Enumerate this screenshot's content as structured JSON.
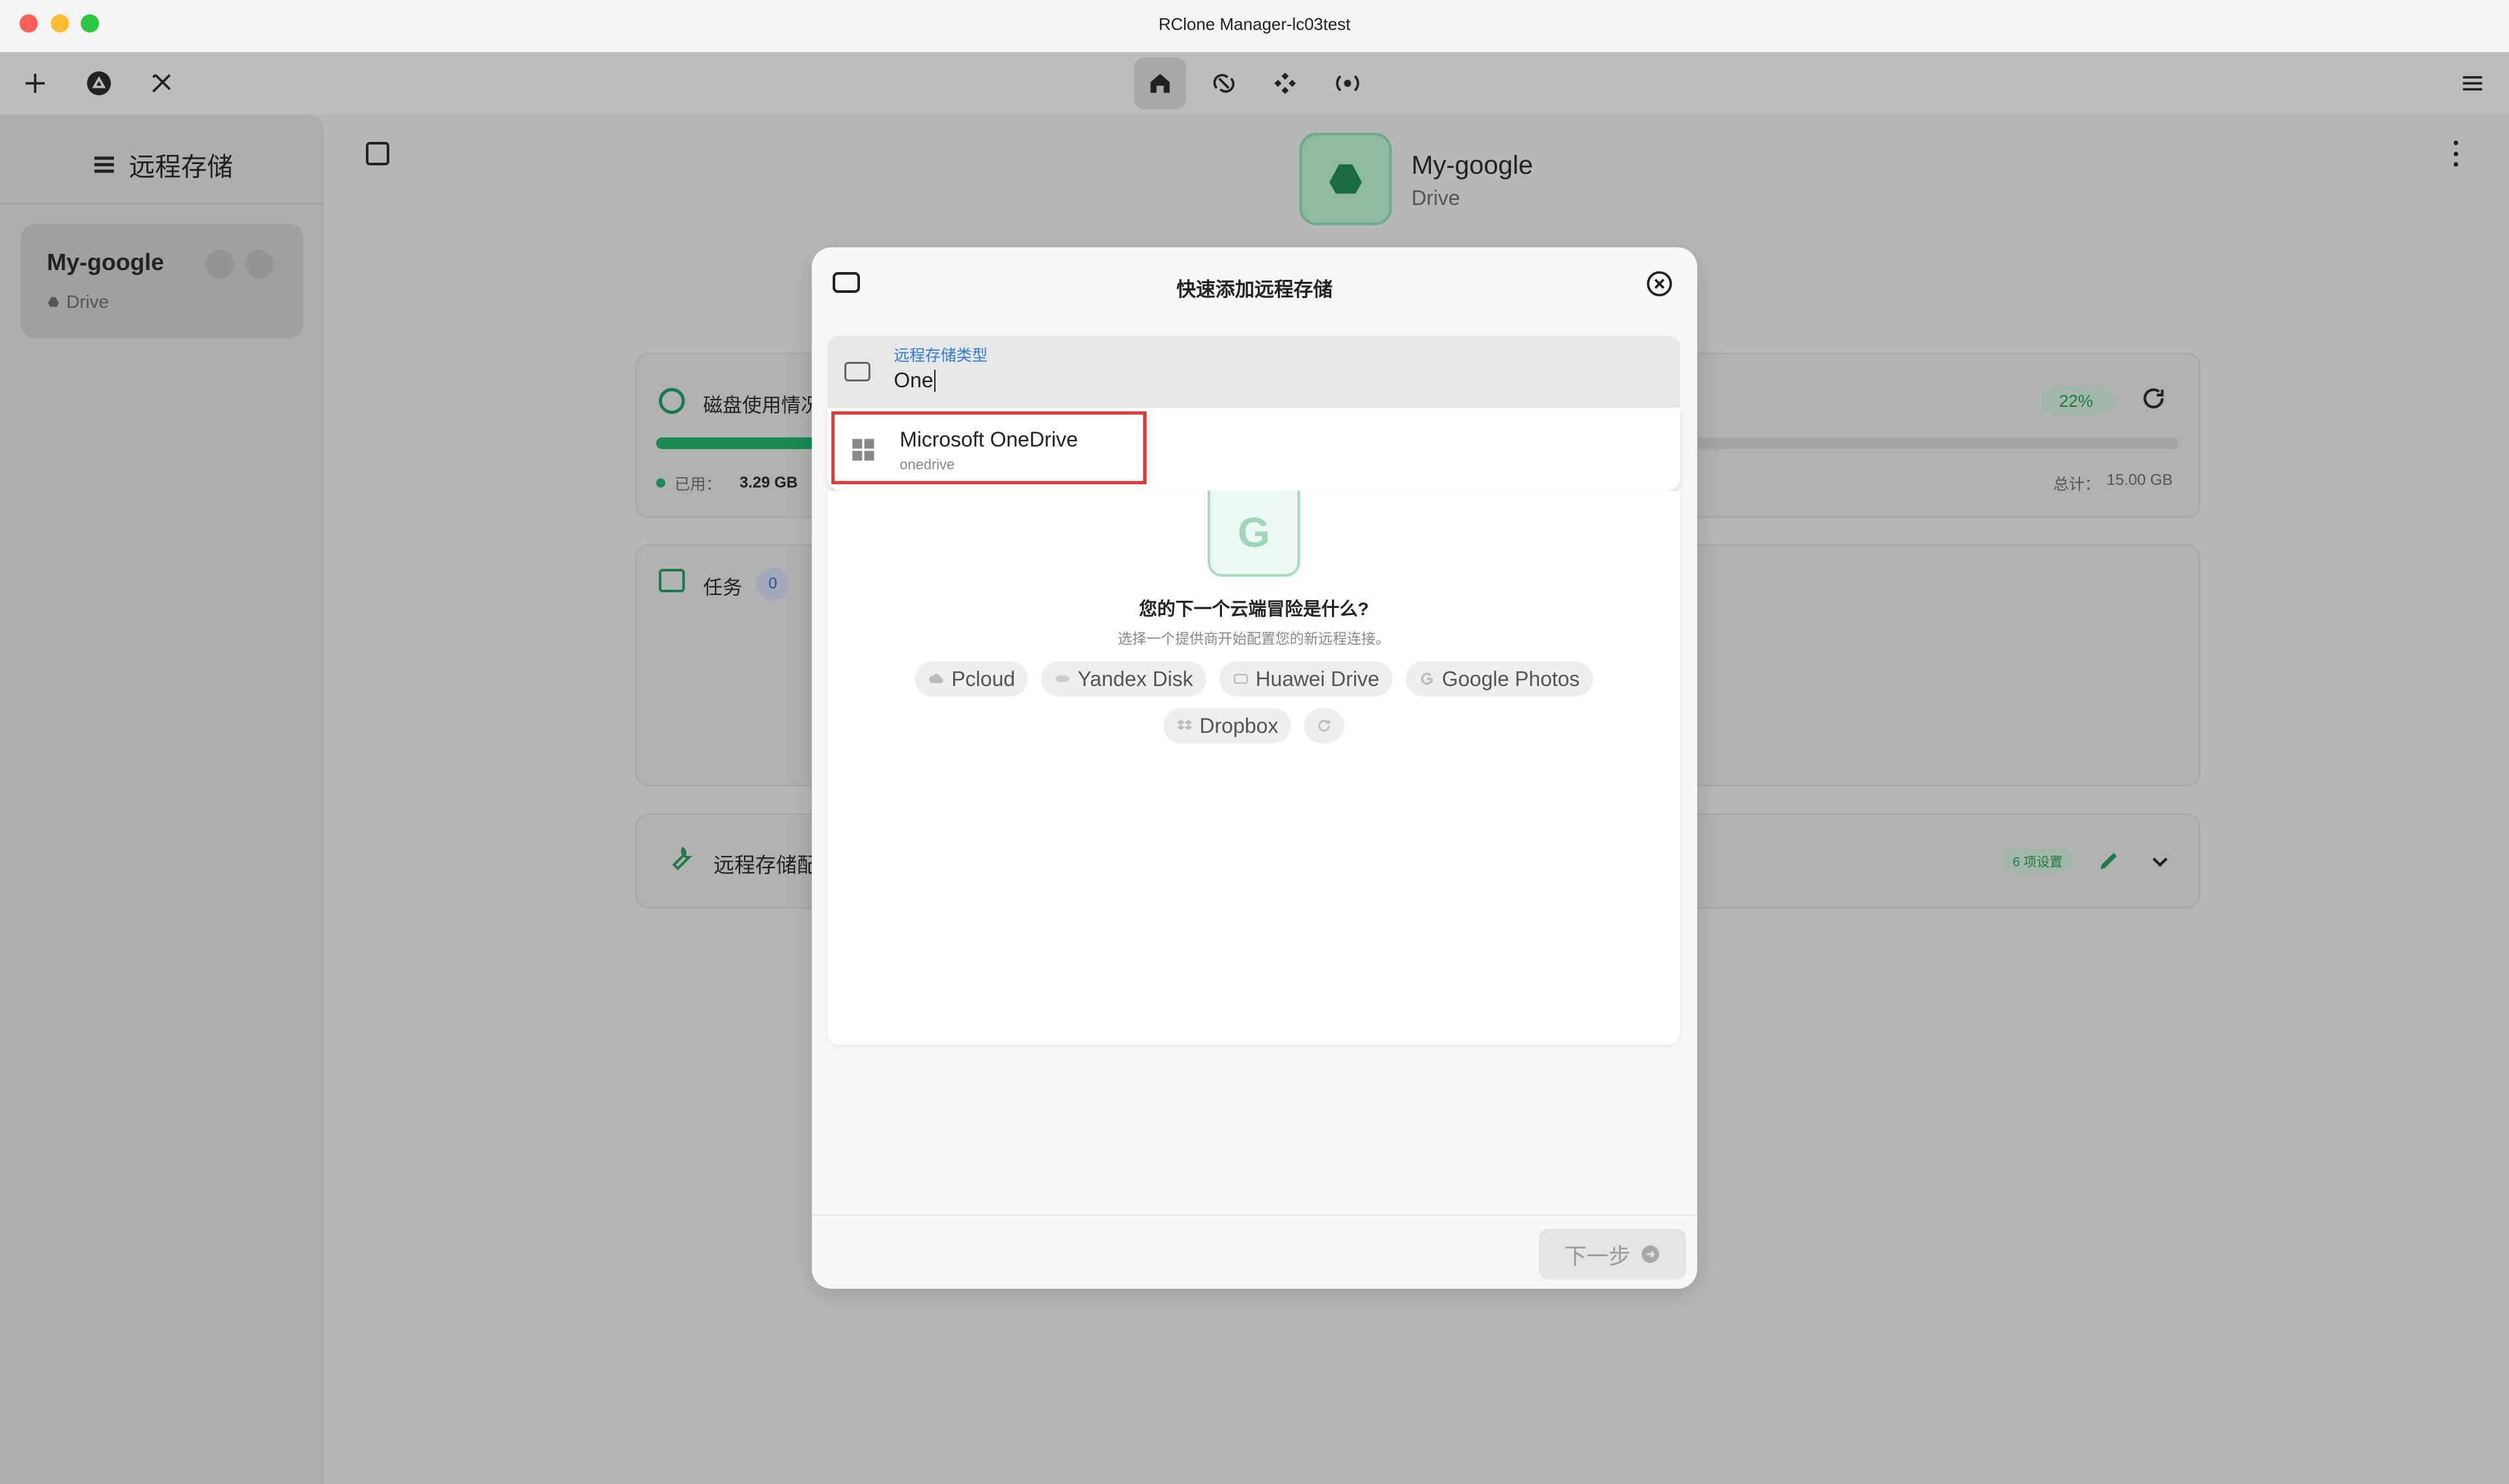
{
  "window": {
    "title": "RClone Manager-lc03test"
  },
  "toolbar": {
    "left_icons": [
      "plus-icon",
      "rclone-logo-icon",
      "tools-icon"
    ],
    "center_icons": [
      "home-icon",
      "sync-icon",
      "mount-icon",
      "serve-icon"
    ],
    "right_icon": "menu-icon"
  },
  "sidebar": {
    "header": "远程存储",
    "remotes": [
      {
        "name": "My-google",
        "type": "Drive"
      }
    ]
  },
  "main": {
    "remote_title": "My-google",
    "remote_subtitle": "Drive",
    "disk": {
      "title_partial": "磁盘使用情况",
      "percent_label": "22%",
      "used_fraction": 0.22,
      "used_label": "已用：",
      "used_value": "3.29 GB",
      "total_label": "总计：",
      "total_value": "15.00 GB"
    },
    "jobs": {
      "title": "任务",
      "count": "0"
    },
    "config": {
      "title_partial": "远程存储配",
      "badge": "6 项设置"
    }
  },
  "modal": {
    "title": "快速添加远程存储",
    "field": {
      "label": "远程存储类型",
      "value": "One"
    },
    "suggestion": {
      "name": "Microsoft OneDrive",
      "id": "onedrive"
    },
    "panel": {
      "logo_letter": "G",
      "heading": "您的下一个云端冒险是什么?",
      "subheading": "选择一个提供商开始配置您的新远程连接。",
      "chips_row1": [
        "Pcloud",
        "Yandex Disk",
        "Huawei Drive",
        "Google Photos"
      ],
      "chips_row2": [
        "Dropbox"
      ]
    },
    "next_button": "下一步"
  },
  "colors": {
    "accent": "#1a9a5a",
    "highlight_border": "#e53935",
    "link_blue": "#2f7ae5"
  }
}
